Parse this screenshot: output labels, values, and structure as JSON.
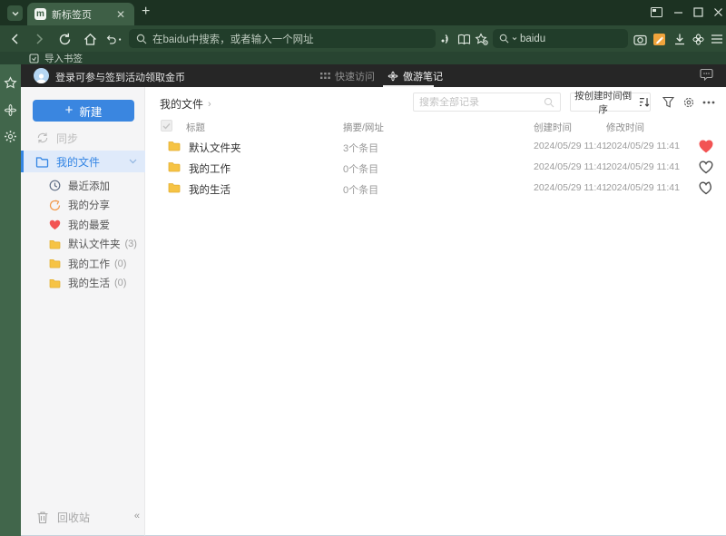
{
  "browser": {
    "tab_title": "新标签页",
    "address_placeholder": "在baidu中搜索，或者输入一个网址",
    "engine_query": "baidu",
    "import_bookmarks_label": "导入书签"
  },
  "page_header": {
    "login_text": "登录可参与签到活动领取金币",
    "tabs": [
      {
        "label": "快速访问",
        "active": false
      },
      {
        "label": "傲游笔记",
        "active": true
      }
    ]
  },
  "sidebar": {
    "new_button_label": "新建",
    "sync_label": "同步",
    "my_files_label": "我的文件",
    "items": [
      {
        "label": "最近添加",
        "count": "",
        "icon": "clock"
      },
      {
        "label": "我的分享",
        "count": "",
        "icon": "share"
      },
      {
        "label": "我的最爱",
        "count": "",
        "icon": "heart"
      },
      {
        "label": "默认文件夹",
        "count": "(3)",
        "icon": "folder"
      },
      {
        "label": "我的工作",
        "count": "(0)",
        "icon": "folder"
      },
      {
        "label": "我的生活",
        "count": "(0)",
        "icon": "folder"
      }
    ],
    "recycle_bin_label": "回收站",
    "collapse_glyph": "«"
  },
  "content": {
    "breadcrumb": "我的文件",
    "search_placeholder": "搜索全部记录",
    "sort_button_label": "按创建时间倒序",
    "table": {
      "headers": {
        "title": "标题",
        "summary": "摘要/网址",
        "created": "创建时间",
        "modified": "修改时间"
      },
      "rows": [
        {
          "title": "默认文件夹",
          "summary": "3个条目",
          "created": "2024/05/29 11:41",
          "modified": "2024/05/29 11:41",
          "favorite": true
        },
        {
          "title": "我的工作",
          "summary": "0个条目",
          "created": "2024/05/29 11:41",
          "modified": "2024/05/29 11:41",
          "favorite": false
        },
        {
          "title": "我的生活",
          "summary": "0个条目",
          "created": "2024/05/29 11:41",
          "modified": "2024/05/29 11:41",
          "favorite": false
        }
      ]
    }
  },
  "colors": {
    "accent_blue": "#3385e4",
    "frame_green_dark": "#1c3222",
    "frame_green": "#2d4b35",
    "heart_red": "#f25353",
    "folder_yellow": "#f6c344",
    "note_orange": "#f0a43c"
  }
}
